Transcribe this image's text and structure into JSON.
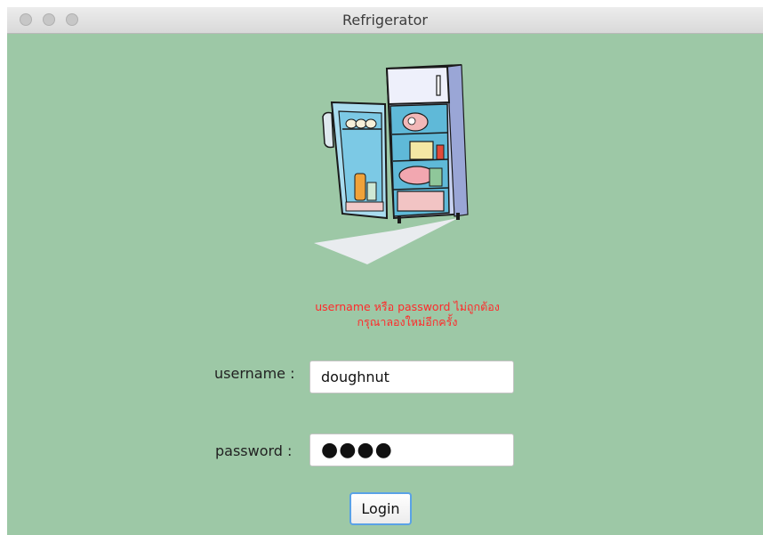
{
  "window": {
    "title": "Refrigerator"
  },
  "illustration": {
    "icon": "open-refrigerator-illustration"
  },
  "error": {
    "line1": "username หรือ password ไม่ถูกต้อง",
    "line2": "กรุณาลองใหม่อีกครั้ง",
    "color": "#ff2a2a"
  },
  "form": {
    "username_label": "username :",
    "username_value": "doughnut",
    "password_label": "password :",
    "password_value": "●●●●",
    "login_label": "Login"
  },
  "colors": {
    "background": "#9dc8a6",
    "focus_ring": "#5aa2e6"
  }
}
